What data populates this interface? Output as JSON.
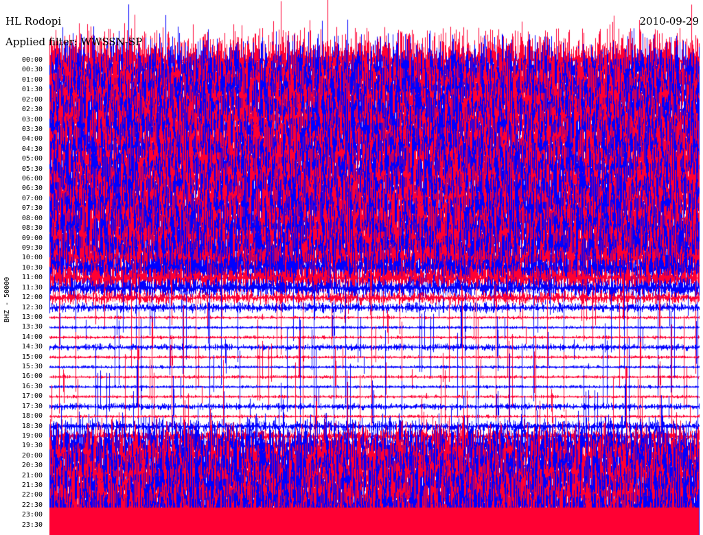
{
  "header": {
    "station": "HL Rodopi",
    "date": "2010-09-29",
    "filter_label": "Applied filter: WWSSN-SP"
  },
  "channel_label": "BHZ - 50000",
  "chart_data": {
    "type": "helicorder",
    "title": "HL Rodopi",
    "subtitle": "Applied filter: WWSSN-SP",
    "ylabel": "BHZ - 50000",
    "trace_colors": [
      "#ff0033",
      "#0000ff"
    ],
    "y_tick_labels": [
      "00:00",
      "00:30",
      "01:00",
      "01:30",
      "02:00",
      "02:30",
      "03:00",
      "03:30",
      "04:00",
      "04:30",
      "05:00",
      "05:30",
      "06:00",
      "06:30",
      "07:00",
      "07:30",
      "08:00",
      "08:30",
      "09:00",
      "09:30",
      "10:00",
      "10:30",
      "11:00",
      "11:30",
      "12:00",
      "12:30",
      "13:00",
      "13:30",
      "14:00",
      "14:30",
      "15:00",
      "15:30",
      "16:00",
      "16:30",
      "17:00",
      "17:30",
      "18:00",
      "18:30",
      "19:00",
      "19:30",
      "20:00",
      "20:30",
      "21:00",
      "21:30",
      "22:00",
      "22:30",
      "23:00",
      "23:30"
    ],
    "relative_amplitude": [
      1.0,
      1.0,
      1.0,
      1.0,
      1.0,
      1.0,
      1.0,
      1.0,
      1.0,
      1.0,
      1.0,
      1.0,
      1.0,
      1.0,
      1.0,
      1.0,
      1.0,
      1.0,
      1.0,
      1.0,
      0.85,
      0.7,
      0.5,
      0.35,
      0.2,
      0.15,
      0.05,
      0.05,
      0.05,
      0.1,
      0.05,
      0.05,
      0.05,
      0.05,
      0.05,
      0.1,
      0.05,
      0.15,
      0.2,
      0.9,
      1.0,
      1.0,
      1.0,
      1.0,
      1.0,
      1.0,
      1.0,
      1.0
    ]
  }
}
